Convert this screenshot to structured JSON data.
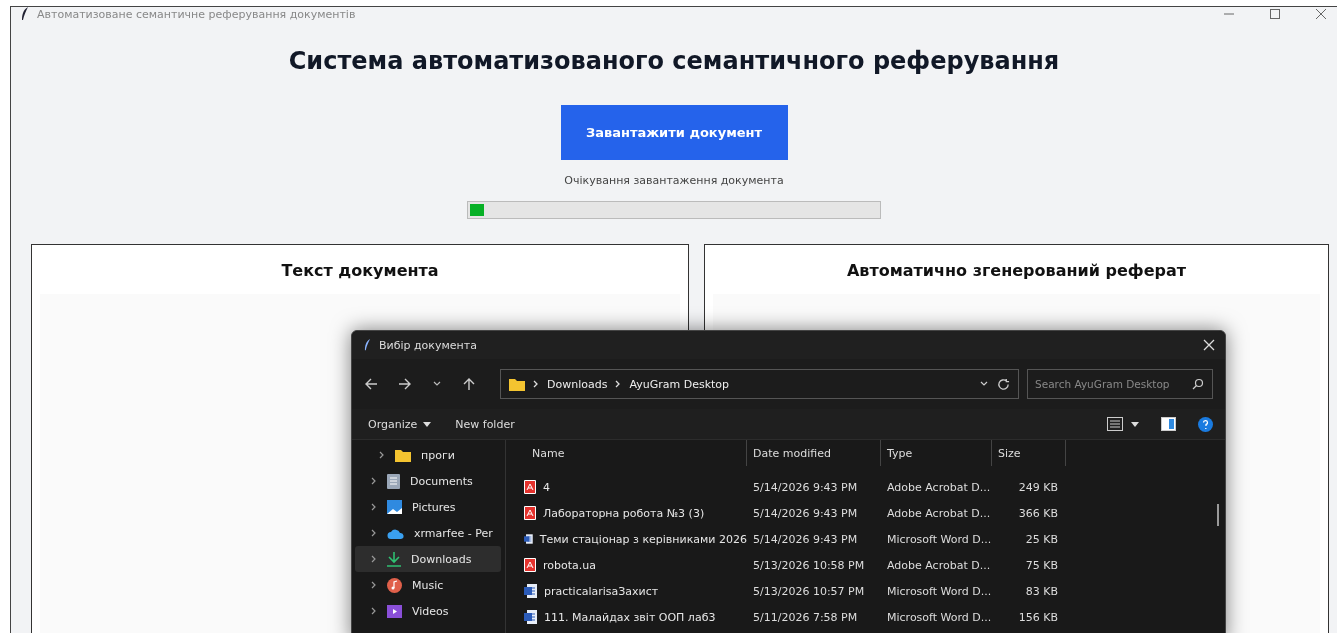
{
  "window": {
    "title": "Автоматизоване семантичне реферування документів"
  },
  "heading": "Система автоматизованого семантичного реферування",
  "upload_button": "Завантажити документ",
  "status": "Очікування завантаження документа",
  "progress": {
    "level": 0.035
  },
  "panels": [
    {
      "title": "Текст документа"
    },
    {
      "title": "Автоматично згенерований реферат"
    }
  ],
  "dialog": {
    "title": "Вибір документа",
    "breadcrumb": [
      "Downloads",
      "AyuGram Desktop"
    ],
    "search": {
      "placeholder": "Search AyuGram Desktop"
    },
    "toolbar": [
      "Organize",
      "New folder"
    ],
    "sidebar": [
      {
        "label": "проги",
        "kind": "folder",
        "selected": false
      },
      {
        "label": "Documents",
        "kind": "documents",
        "selected": false
      },
      {
        "label": "Pictures",
        "kind": "pictures",
        "selected": false
      },
      {
        "label": "xrmarfee - Per",
        "kind": "cloud",
        "selected": false
      },
      {
        "label": "Downloads",
        "kind": "downloads",
        "selected": true
      },
      {
        "label": "Music",
        "kind": "music",
        "selected": false
      },
      {
        "label": "Videos",
        "kind": "videos",
        "selected": false
      }
    ],
    "columns": [
      "Name",
      "Date modified",
      "Type",
      "Size"
    ],
    "rows": [
      {
        "kind": "pdf",
        "name": "4",
        "date": "5/14/2026 9:43 PM",
        "type": "Adobe Acrobat D...",
        "size": "249 KB"
      },
      {
        "kind": "pdf",
        "name": "Лабораторна робота №3 (3)",
        "date": "5/14/2026 9:43 PM",
        "type": "Adobe Acrobat D...",
        "size": "366 KB"
      },
      {
        "kind": "word",
        "name": "Теми стаціонар з керівниками 2026",
        "date": "5/14/2026 9:43 PM",
        "type": "Microsoft Word D...",
        "size": "25 KB"
      },
      {
        "kind": "pdf",
        "name": "robota.ua",
        "date": "5/13/2026 10:58 PM",
        "type": "Adobe Acrobat D...",
        "size": "75 KB"
      },
      {
        "kind": "word",
        "name": "practicalarisaЗахист",
        "date": "5/13/2026 10:57 PM",
        "type": "Microsoft Word D...",
        "size": "83 KB"
      },
      {
        "kind": "word",
        "name": "111. Малайдах звіт ООП лаб3",
        "date": "5/11/2026 7:58 PM",
        "type": "Microsoft Word D...",
        "size": "156 KB"
      }
    ]
  }
}
